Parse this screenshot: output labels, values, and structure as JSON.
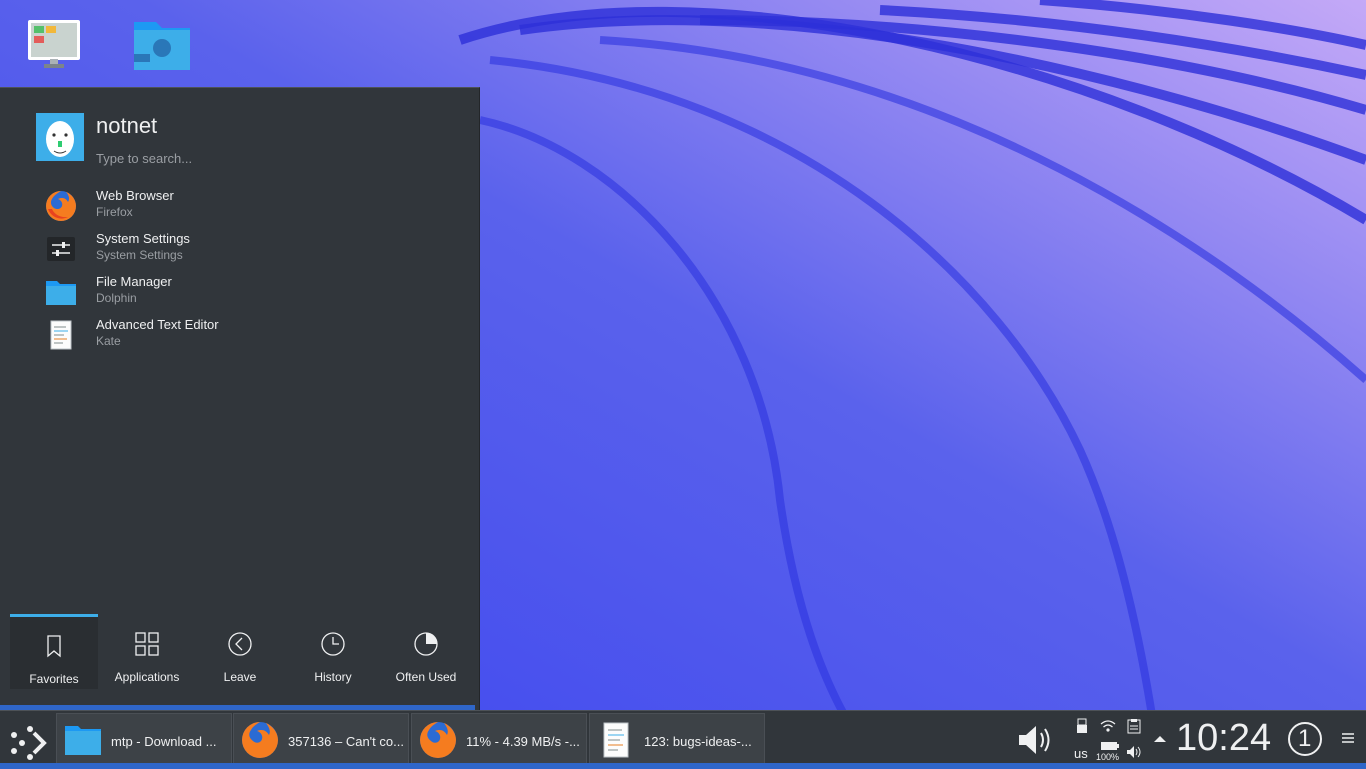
{
  "launcher": {
    "username": "notnet",
    "search_placeholder": "Type to search...",
    "favorites": [
      {
        "name": "Web Browser",
        "sub": "Firefox",
        "icon": "firefox-icon"
      },
      {
        "name": "System Settings",
        "sub": "System Settings",
        "icon": "settings-icon"
      },
      {
        "name": "File Manager",
        "sub": "Dolphin",
        "icon": "folder-icon"
      },
      {
        "name": "Advanced Text Editor",
        "sub": "Kate",
        "icon": "text-editor-icon"
      }
    ],
    "tabs": [
      {
        "label": "Favorites",
        "icon": "bookmark-icon",
        "active": true
      },
      {
        "label": "Applications",
        "icon": "grid-icon"
      },
      {
        "label": "Leave",
        "icon": "leave-icon"
      },
      {
        "label": "History",
        "icon": "clock-icon"
      },
      {
        "label": "Often Used",
        "icon": "pie-icon"
      }
    ]
  },
  "taskbar": {
    "tasks": [
      {
        "label": "mtp - Download ...",
        "icon": "folder-icon"
      },
      {
        "label": "357136 – Can't co...",
        "icon": "firefox-icon"
      },
      {
        "label": "11% - 4.39 MB/s -...",
        "icon": "firefox-icon"
      },
      {
        "label": "123: bugs-ideas-...",
        "icon": "text-editor-icon"
      }
    ],
    "tray": {
      "keyboard_layout": "us",
      "battery_percent": "100%",
      "clock": "10:24",
      "virtual_desktop": "1"
    }
  },
  "colors": {
    "panel_bg": "#31363b",
    "accent": "#3daee9",
    "panel_border_blue": "#2f66c9"
  }
}
